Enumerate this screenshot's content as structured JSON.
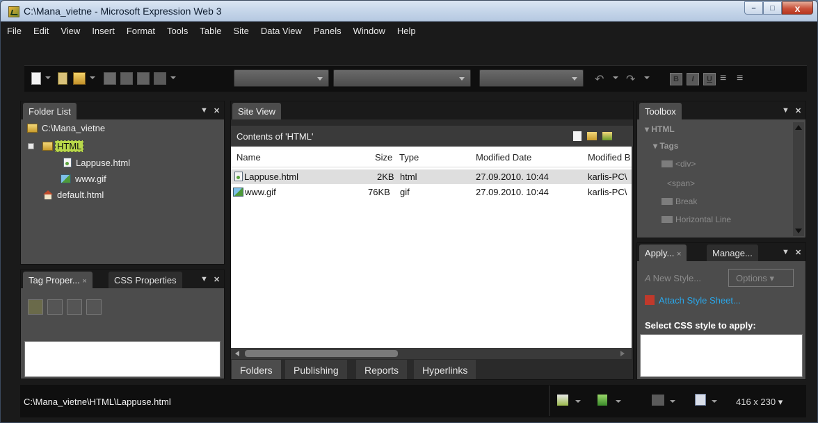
{
  "window": {
    "title": "C:\\Mana_vietne - Microsoft Expression Web 3",
    "minimize": "–",
    "maximize": "□",
    "close": "x"
  },
  "menu": [
    "File",
    "Edit",
    "View",
    "Insert",
    "Format",
    "Tools",
    "Table",
    "Site",
    "Data View",
    "Panels",
    "Window",
    "Help"
  ],
  "toolbar": {
    "bold": "B",
    "italic": "I",
    "underline": "U"
  },
  "folder_list": {
    "tab": "Folder List",
    "root": "C:\\Mana_vietne",
    "folder": "HTML",
    "files": [
      "Lappuse.html",
      "www.gif"
    ],
    "default": "default.html"
  },
  "tag_panel": {
    "tab1": "Tag Proper...",
    "tab2": "CSS Properties"
  },
  "site_view": {
    "tab": "Site View",
    "contents_label": "Contents of 'HTML'",
    "columns": [
      "Name",
      "Size",
      "Type",
      "Modified Date",
      "Modified B"
    ],
    "rows": [
      {
        "name": "Lappuse.html",
        "size": "2KB",
        "type": "html",
        "date": "27.09.2010. 10:44",
        "by": "karlis-PC\\"
      },
      {
        "name": "www.gif",
        "size": "76KB",
        "type": "gif",
        "date": "27.09.2010. 10:44",
        "by": "karlis-PC\\"
      }
    ],
    "bottom_tabs": [
      "Folders",
      "Publishing",
      "Reports",
      "Hyperlinks"
    ]
  },
  "toolbox": {
    "tab": "Toolbox",
    "section": "HTML",
    "subsection": "Tags",
    "items": [
      "<div>",
      "<span>",
      "Break",
      "Horizontal Line"
    ]
  },
  "apply_panel": {
    "tab1": "Apply...",
    "tab2": "Manage...",
    "new_style": "New Style...",
    "options": "Options",
    "attach": "Attach Style Sheet...",
    "select_label": "Select CSS style to apply:"
  },
  "status": {
    "path": "C:\\Mana_vietne\\HTML\\Lappuse.html",
    "size": "416 x 230"
  }
}
